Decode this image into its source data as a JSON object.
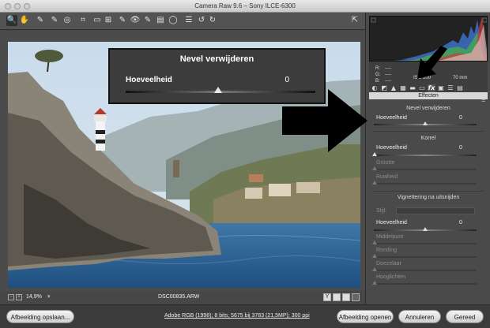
{
  "window": {
    "title": "Camera Raw 9.6  –  Sony ILCE-6300"
  },
  "toolbar": {
    "tools": [
      {
        "name": "zoom-tool",
        "glyph": "🔍"
      },
      {
        "name": "hand-tool",
        "glyph": "✋"
      },
      {
        "name": "white-balance-tool",
        "glyph": "✎"
      },
      {
        "name": "color-sampler-tool",
        "glyph": "✎"
      },
      {
        "name": "target-adjust-tool",
        "glyph": "◎"
      },
      {
        "name": "crop-tool",
        "glyph": "⌗"
      },
      {
        "name": "straighten-tool",
        "glyph": "▭"
      },
      {
        "name": "transform-tool",
        "glyph": "⊞"
      },
      {
        "name": "spot-removal-tool",
        "glyph": "✎"
      },
      {
        "name": "red-eye-tool",
        "glyph": "👁"
      },
      {
        "name": "adjustment-brush-tool",
        "glyph": "✎"
      },
      {
        "name": "graduated-filter-tool",
        "glyph": "▤"
      },
      {
        "name": "radial-filter-tool",
        "glyph": "◯"
      },
      {
        "name": "preferences-tool",
        "glyph": "☰"
      },
      {
        "name": "rotate-left-tool",
        "glyph": "↺"
      },
      {
        "name": "rotate-right-tool",
        "glyph": "↻"
      }
    ],
    "fullscreen_glyph": "⇱"
  },
  "overlay": {
    "title": "Nevel verwijderen",
    "label": "Hoeveelheid",
    "value": "0"
  },
  "status": {
    "zoom": "14,9%",
    "filename": "DSC00835.ARW",
    "minus": "−",
    "plus": "+",
    "view_y": "Y"
  },
  "histogram": {
    "metadata": {
      "r_label": "R:",
      "g_label": "G:",
      "b_label": "B:",
      "r_value": "----",
      "g_value": "----",
      "b_value": "----",
      "aperture": "f/",
      "iso": "ISO 100",
      "focal": "70 mm"
    }
  },
  "panel": {
    "header": "Effecten",
    "sections": {
      "nevel": {
        "title": "Nevel verwijderen",
        "sliders": [
          {
            "label": "Hoeveelheid",
            "value": "0",
            "pos": 0.5
          }
        ]
      },
      "korrel": {
        "title": "Korrel",
        "sliders": [
          {
            "label": "Hoeveelheid",
            "value": "0",
            "pos": 0.0
          },
          {
            "label": "Grootte",
            "value": "",
            "pos": 0.0,
            "dim": true
          },
          {
            "label": "Ruwheid",
            "value": "",
            "pos": 0.0,
            "dim": true
          }
        ]
      },
      "vignet": {
        "title": "Vignettering na uitsnijden",
        "stijl_label": "Stijl:",
        "sliders": [
          {
            "label": "Hoeveelheid",
            "value": "0",
            "pos": 0.5
          },
          {
            "label": "Middelpunt",
            "value": "",
            "pos": 0.0,
            "dim": true
          },
          {
            "label": "Ronding",
            "value": "",
            "pos": 0.0,
            "dim": true
          },
          {
            "label": "Doezelaar",
            "value": "",
            "pos": 0.0,
            "dim": true
          },
          {
            "label": "Hooglichten",
            "value": "",
            "pos": 0.0,
            "dim": true
          }
        ]
      }
    }
  },
  "bottom": {
    "save": "Afbeelding opslaan...",
    "workflow": "Adobe RGB (1998); 8 bits; 5675 bij 3783 (21,5MP); 300 ppi",
    "open": "Afbeelding openen",
    "cancel": "Annuleren",
    "done": "Gereed"
  },
  "colors": {
    "accent": "#f0f0f0",
    "panel": "#4a4a4a",
    "sea": "#2a5a8a"
  }
}
